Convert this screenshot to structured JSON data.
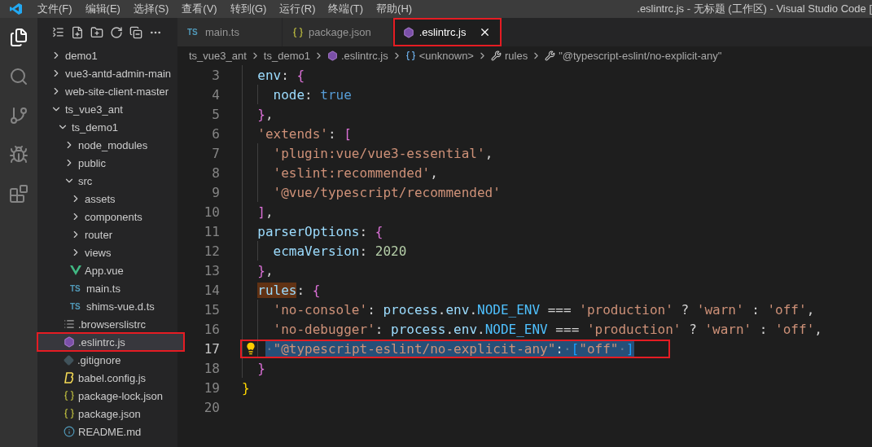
{
  "window": {
    "title": ".eslintrc.js - 无标题 (工作区) - Visual Studio Code ["
  },
  "menu": [
    "文件(F)",
    "编辑(E)",
    "选择(S)",
    "查看(V)",
    "转到(G)",
    "运行(R)",
    "终端(T)",
    "帮助(H)"
  ],
  "activity_bar": [
    {
      "kind": "explorer",
      "selected": true
    },
    {
      "kind": "search",
      "selected": false
    },
    {
      "kind": "scm",
      "selected": false
    },
    {
      "kind": "debug",
      "selected": false
    },
    {
      "kind": "extensions",
      "selected": false
    }
  ],
  "explorer": {
    "tree": [
      {
        "label": "demo1",
        "kind": "folder",
        "expanded": false,
        "selected": false,
        "annotated": false
      },
      {
        "label": "vue3-antd-admin-main",
        "kind": "folder",
        "expanded": false,
        "selected": false,
        "annotated": false
      },
      {
        "label": "web-site-client-master",
        "kind": "folder",
        "expanded": false,
        "selected": false,
        "annotated": false
      },
      {
        "label": "ts_vue3_ant",
        "kind": "folder",
        "expanded": true,
        "selected": false,
        "annotated": false,
        "children": [
          {
            "label": "ts_demo1",
            "kind": "folder",
            "expanded": true,
            "selected": false,
            "annotated": false,
            "children": [
              {
                "label": "node_modules",
                "kind": "folder",
                "expanded": false,
                "selected": false,
                "annotated": false
              },
              {
                "label": "public",
                "kind": "folder",
                "expanded": false,
                "selected": false,
                "annotated": false
              },
              {
                "label": "src",
                "kind": "folder",
                "expanded": true,
                "selected": false,
                "annotated": false,
                "children": [
                  {
                    "label": "assets",
                    "kind": "folder",
                    "expanded": false,
                    "selected": false,
                    "annotated": false
                  },
                  {
                    "label": "components",
                    "kind": "folder",
                    "expanded": false,
                    "selected": false,
                    "annotated": false
                  },
                  {
                    "label": "router",
                    "kind": "folder",
                    "expanded": false,
                    "selected": false,
                    "annotated": false
                  },
                  {
                    "label": "views",
                    "kind": "folder",
                    "expanded": false,
                    "selected": false,
                    "annotated": false
                  },
                  {
                    "label": "App.vue",
                    "kind": "vue",
                    "selected": false,
                    "annotated": false
                  },
                  {
                    "label": "main.ts",
                    "kind": "ts",
                    "icon_text": "TS",
                    "selected": false,
                    "annotated": false
                  },
                  {
                    "label": "shims-vue.d.ts",
                    "kind": "ts",
                    "icon_text": "TS",
                    "selected": false,
                    "annotated": false
                  }
                ]
              },
              {
                "label": ".browserslistrc",
                "kind": "list",
                "selected": false,
                "annotated": false
              },
              {
                "label": ".eslintrc.js",
                "kind": "eslint",
                "selected": true,
                "annotated": true
              },
              {
                "label": ".gitignore",
                "kind": "git",
                "selected": false,
                "annotated": false
              },
              {
                "label": "babel.config.js",
                "kind": "babel",
                "selected": false,
                "annotated": false
              },
              {
                "label": "package-lock.json",
                "kind": "json",
                "selected": false,
                "annotated": false
              },
              {
                "label": "package.json",
                "kind": "json",
                "selected": false,
                "annotated": false
              },
              {
                "label": "README.md",
                "kind": "info",
                "selected": false,
                "annotated": false
              }
            ]
          }
        ]
      }
    ]
  },
  "tabs": [
    {
      "label": "main.ts",
      "kind": "ts",
      "icon_text": "TS",
      "selected": false,
      "annotated": false
    },
    {
      "label": "package.json",
      "kind": "json",
      "selected": false,
      "annotated": false
    },
    {
      "label": ".eslintrc.js",
      "kind": "eslint",
      "selected": true,
      "annotated": true
    }
  ],
  "breadcrumb": [
    {
      "label": "ts_vue3_ant",
      "kind": "folder"
    },
    {
      "label": "ts_demo1",
      "kind": "folder"
    },
    {
      "label": ".eslintrc.js",
      "kind": "eslint"
    },
    {
      "label": "<unknown>",
      "kind": "variable"
    },
    {
      "label": "rules",
      "kind": "property"
    },
    {
      "label": "\"@typescript-eslint/no-explicit-any\"",
      "kind": "property"
    }
  ],
  "code": [
    {
      "number": "3",
      "current": false,
      "lightbulb": false,
      "annotated": false,
      "tokens": [
        {
          "kind": "prop",
          "text": "  env"
        },
        {
          "kind": "punct",
          "text": ": "
        },
        {
          "kind": "brace2",
          "text": "{"
        }
      ]
    },
    {
      "number": "4",
      "current": false,
      "lightbulb": false,
      "annotated": false,
      "tokens": [
        {
          "kind": "prop",
          "text": "    node"
        },
        {
          "kind": "punct",
          "text": ": "
        },
        {
          "kind": "keyword",
          "text": "true"
        }
      ]
    },
    {
      "number": "5",
      "current": false,
      "lightbulb": false,
      "annotated": false,
      "tokens": [
        {
          "kind": "brace2",
          "text": "  }"
        },
        {
          "kind": "punct",
          "text": ","
        }
      ]
    },
    {
      "number": "6",
      "current": false,
      "lightbulb": false,
      "annotated": false,
      "tokens": [
        {
          "kind": "string",
          "text": "  'extends'"
        },
        {
          "kind": "punct",
          "text": ": "
        },
        {
          "kind": "brace2",
          "text": "["
        }
      ]
    },
    {
      "number": "7",
      "current": false,
      "lightbulb": false,
      "annotated": false,
      "tokens": [
        {
          "kind": "string",
          "text": "    'plugin:vue/vue3-essential'"
        },
        {
          "kind": "punct",
          "text": ","
        }
      ]
    },
    {
      "number": "8",
      "current": false,
      "lightbulb": false,
      "annotated": false,
      "tokens": [
        {
          "kind": "string",
          "text": "    'eslint:recommended'"
        },
        {
          "kind": "punct",
          "text": ","
        }
      ]
    },
    {
      "number": "9",
      "current": false,
      "lightbulb": false,
      "annotated": false,
      "tokens": [
        {
          "kind": "string",
          "text": "    '@vue/typescript/recommended'"
        }
      ]
    },
    {
      "number": "10",
      "current": false,
      "lightbulb": false,
      "annotated": false,
      "tokens": [
        {
          "kind": "brace2",
          "text": "  ]"
        },
        {
          "kind": "punct",
          "text": ","
        }
      ]
    },
    {
      "number": "11",
      "current": false,
      "lightbulb": false,
      "annotated": false,
      "tokens": [
        {
          "kind": "prop",
          "text": "  parserOptions"
        },
        {
          "kind": "punct",
          "text": ": "
        },
        {
          "kind": "brace2",
          "text": "{"
        }
      ]
    },
    {
      "number": "12",
      "current": false,
      "lightbulb": false,
      "annotated": false,
      "tokens": [
        {
          "kind": "prop",
          "text": "    ecmaVersion"
        },
        {
          "kind": "punct",
          "text": ": "
        },
        {
          "kind": "number",
          "text": "2020"
        }
      ]
    },
    {
      "number": "13",
      "current": false,
      "lightbulb": false,
      "annotated": false,
      "tokens": [
        {
          "kind": "brace2",
          "text": "  }"
        },
        {
          "kind": "punct",
          "text": ","
        }
      ]
    },
    {
      "number": "14",
      "current": false,
      "lightbulb": false,
      "annotated": false,
      "tokens": [
        {
          "kind": "prop",
          "text": "  rules",
          "marked": true
        },
        {
          "kind": "punct",
          "text": ": "
        },
        {
          "kind": "brace2",
          "text": "{"
        }
      ]
    },
    {
      "number": "15",
      "current": false,
      "lightbulb": false,
      "annotated": false,
      "tokens": [
        {
          "kind": "string",
          "text": "    'no-console'"
        },
        {
          "kind": "punct",
          "text": ": "
        },
        {
          "kind": "prop",
          "text": "process"
        },
        {
          "kind": "punct",
          "text": "."
        },
        {
          "kind": "prop",
          "text": "env"
        },
        {
          "kind": "punct",
          "text": "."
        },
        {
          "kind": "constant",
          "text": "NODE_ENV"
        },
        {
          "kind": "punct",
          "text": " === "
        },
        {
          "kind": "string",
          "text": "'production'"
        },
        {
          "kind": "punct",
          "text": " ? "
        },
        {
          "kind": "string",
          "text": "'warn'"
        },
        {
          "kind": "punct",
          "text": " : "
        },
        {
          "kind": "string",
          "text": "'off'"
        },
        {
          "kind": "punct",
          "text": ","
        }
      ]
    },
    {
      "number": "16",
      "current": false,
      "lightbulb": false,
      "annotated": false,
      "tokens": [
        {
          "kind": "string",
          "text": "    'no-debugger'"
        },
        {
          "kind": "punct",
          "text": ": "
        },
        {
          "kind": "prop",
          "text": "process"
        },
        {
          "kind": "punct",
          "text": "."
        },
        {
          "kind": "prop",
          "text": "env"
        },
        {
          "kind": "punct",
          "text": "."
        },
        {
          "kind": "constant",
          "text": "NODE_ENV"
        },
        {
          "kind": "punct",
          "text": " === "
        },
        {
          "kind": "string",
          "text": "'production'"
        },
        {
          "kind": "punct",
          "text": " ? "
        },
        {
          "kind": "string",
          "text": "'warn'"
        },
        {
          "kind": "punct",
          "text": " : "
        },
        {
          "kind": "string",
          "text": "'off'"
        },
        {
          "kind": "punct",
          "text": ","
        }
      ]
    },
    {
      "number": "17",
      "current": true,
      "lightbulb": true,
      "annotated": true,
      "tokens": [
        {
          "kind": "whitespace",
          "text": "   ·",
          "selected": true
        },
        {
          "kind": "string",
          "text": "\"@typescript-eslint/no-explicit-any\"",
          "selected": true
        },
        {
          "kind": "punct",
          "text": ":",
          "selected": true
        },
        {
          "kind": "whitespace",
          "text": "·",
          "selected": true
        },
        {
          "kind": "brace3",
          "text": "[",
          "selected": true
        },
        {
          "kind": "string",
          "text": "\"off\"",
          "selected": true
        },
        {
          "kind": "whitespace",
          "text": "·",
          "selected": true
        },
        {
          "kind": "brace3",
          "text": "]",
          "selected": true
        }
      ]
    },
    {
      "number": "18",
      "current": false,
      "lightbulb": false,
      "annotated": false,
      "tokens": [
        {
          "kind": "brace2",
          "text": "  }"
        }
      ]
    },
    {
      "number": "19",
      "current": false,
      "lightbulb": false,
      "annotated": false,
      "tokens": [
        {
          "kind": "brace1",
          "text": "}"
        }
      ]
    },
    {
      "number": "20",
      "current": false,
      "lightbulb": false
    }
  ]
}
